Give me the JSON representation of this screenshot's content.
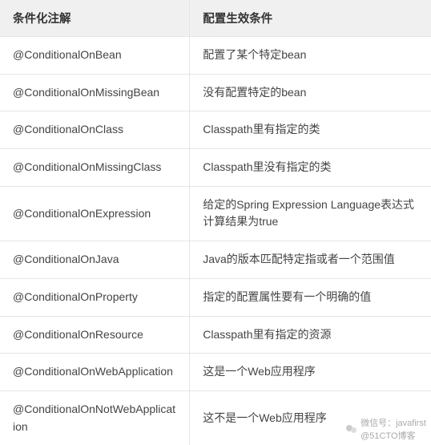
{
  "table": {
    "headers": {
      "col1": "条件化注解",
      "col2": "配置生效条件"
    },
    "rows": [
      {
        "annotation": "@ConditionalOnBean",
        "condition": "配置了某个特定bean"
      },
      {
        "annotation": "@ConditionalOnMissingBean",
        "condition": "没有配置特定的bean"
      },
      {
        "annotation": "@ConditionalOnClass",
        "condition": "Classpath里有指定的类"
      },
      {
        "annotation": "@ConditionalOnMissingClass",
        "condition": "Classpath里没有指定的类"
      },
      {
        "annotation": "@ConditionalOnExpression",
        "condition": "给定的Spring Expression Language表达式计算结果为true"
      },
      {
        "annotation": "@ConditionalOnJava",
        "condition": "Java的版本匹配特定指或者一个范围值"
      },
      {
        "annotation": "@ConditionalOnProperty",
        "condition": "指定的配置属性要有一个明确的值"
      },
      {
        "annotation": "@ConditionalOnResource",
        "condition": "Classpath里有指定的资源"
      },
      {
        "annotation": "@ConditionalOnWebApplication",
        "condition": "这是一个Web应用程序"
      },
      {
        "annotation": "@ConditionalOnNotWebApplication",
        "condition": "这不是一个Web应用程序"
      }
    ]
  },
  "watermark": {
    "line1": "微信号：javafirst",
    "line2": "@51CTO博客"
  }
}
